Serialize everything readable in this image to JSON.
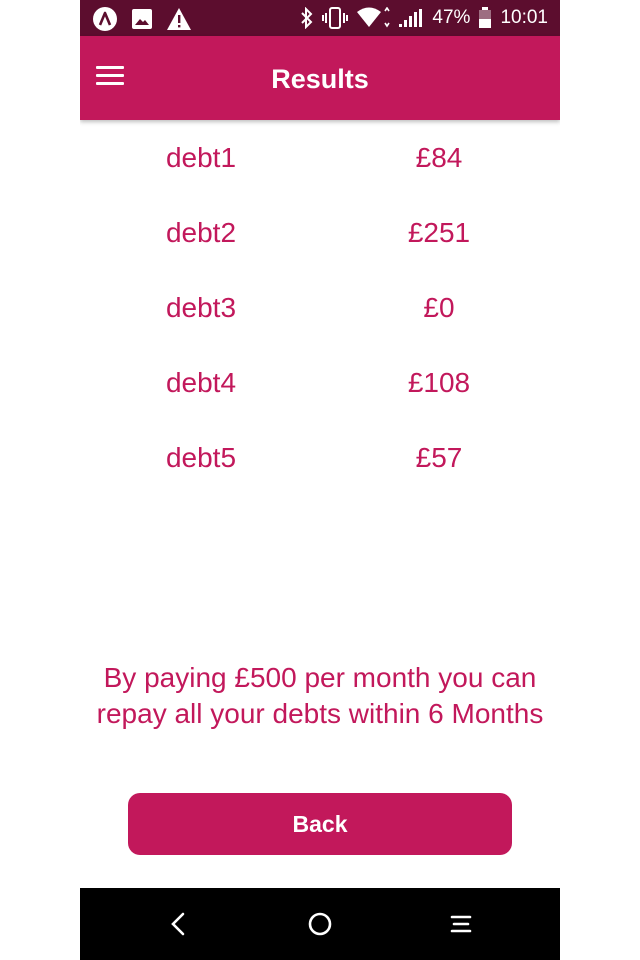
{
  "status_bar": {
    "battery": "47%",
    "time": "10:01",
    "icons": [
      "app-a-icon",
      "image-icon",
      "warning-icon",
      "bluetooth-icon",
      "vibrate-icon",
      "wifi-icon",
      "signal-icon",
      "battery-icon"
    ]
  },
  "app_bar": {
    "title": "Results",
    "menu_icon": "hamburger-menu-icon"
  },
  "debts": [
    {
      "name": "debt1",
      "amount": "£84"
    },
    {
      "name": "debt2",
      "amount": "£251"
    },
    {
      "name": "debt3",
      "amount": "£0"
    },
    {
      "name": "debt4",
      "amount": "£108"
    },
    {
      "name": "debt5",
      "amount": "£57"
    }
  ],
  "summary": {
    "line1": "By paying £500 per month you can",
    "line2": "repay all your debts within 6 Months"
  },
  "back_button": {
    "label": "Back"
  },
  "nav_bar": {
    "icons": [
      "back-icon",
      "home-icon",
      "recents-icon"
    ]
  },
  "colors": {
    "primary": "#c2185b",
    "status_bar": "#5c0d2e",
    "nav_bar": "#000000",
    "background": "#ffffff"
  }
}
